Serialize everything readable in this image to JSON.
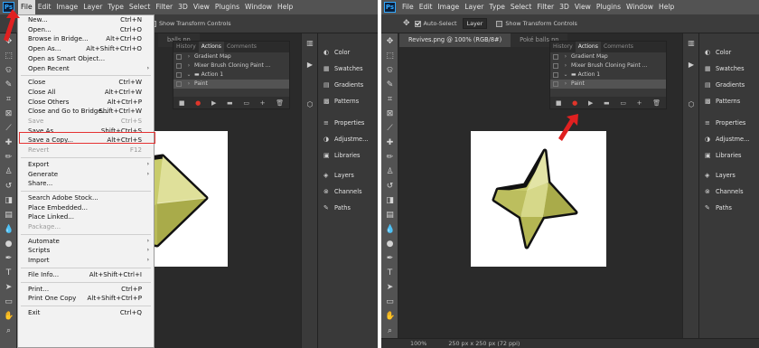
{
  "menubar_items": [
    "File",
    "Edit",
    "Image",
    "Layer",
    "Type",
    "Select",
    "Filter",
    "3D",
    "View",
    "Plugins",
    "Window",
    "Help"
  ],
  "ps_logo": "Ps",
  "options": {
    "auto_select": "Auto-Select",
    "layer_dropdown": "Layer",
    "show_transform": "Show Transform Controls"
  },
  "doc_tabs": {
    "active": "Revives.png @ 100% (RGB/8#)",
    "other": "Poké balls.pn"
  },
  "left_tab_partial": "balls.pn",
  "panel_tabs": [
    "History",
    "Actions",
    "Comments"
  ],
  "actions_rows_left": [
    "Gradient Map",
    "Mixer Brush Cloning Paint ...",
    "Action 1",
    "Paint"
  ],
  "actions_rows_right": [
    "Gradient Map",
    "Mixer Brush Cloning Paint ...",
    "Action 1",
    "Paint"
  ],
  "action_buttons": [
    "■",
    "●",
    "▶",
    "▬",
    "▭",
    "+",
    "🗑"
  ],
  "right_panels": [
    "Color",
    "Swatches",
    "Gradients",
    "Patterns",
    "Properties",
    "Adjustme...",
    "Libraries",
    "Layers",
    "Channels",
    "Paths"
  ],
  "right_icons": [
    "gradient-icon",
    "play-icon",
    "cube-icon"
  ],
  "status": {
    "zoom": "100%",
    "size": "250 px x 250 px (72 ppi)"
  },
  "file_menu": [
    {
      "label": "New...",
      "key": "Ctrl+N"
    },
    {
      "label": "Open...",
      "key": "Ctrl+O"
    },
    {
      "label": "Browse in Bridge...",
      "key": "Alt+Ctrl+O"
    },
    {
      "label": "Open As...",
      "key": "Alt+Shift+Ctrl+O"
    },
    {
      "label": "Open as Smart Object...",
      "key": ""
    },
    {
      "label": "Open Recent",
      "key": "",
      "sub": true
    },
    {
      "sep": true
    },
    {
      "label": "Close",
      "key": "Ctrl+W"
    },
    {
      "label": "Close All",
      "key": "Alt+Ctrl+W"
    },
    {
      "label": "Close Others",
      "key": "Alt+Ctrl+P"
    },
    {
      "label": "Close and Go to Bridge...",
      "key": "Shift+Ctrl+W"
    },
    {
      "label": "Save",
      "key": "Ctrl+S",
      "disabled": true
    },
    {
      "label": "Save As...",
      "key": "Shift+Ctrl+S"
    },
    {
      "label": "Save a Copy...",
      "key": "Alt+Ctrl+S"
    },
    {
      "label": "Revert",
      "key": "F12",
      "disabled": true
    },
    {
      "sep": true
    },
    {
      "label": "Export",
      "key": "",
      "sub": true
    },
    {
      "label": "Generate",
      "key": "",
      "sub": true
    },
    {
      "label": "Share...",
      "key": ""
    },
    {
      "sep": true
    },
    {
      "label": "Search Adobe Stock...",
      "key": ""
    },
    {
      "label": "Place Embedded...",
      "key": ""
    },
    {
      "label": "Place Linked...",
      "key": ""
    },
    {
      "label": "Package...",
      "key": "",
      "disabled": true
    },
    {
      "sep": true
    },
    {
      "label": "Automate",
      "key": "",
      "sub": true
    },
    {
      "label": "Scripts",
      "key": "",
      "sub": true
    },
    {
      "label": "Import",
      "key": "",
      "sub": true
    },
    {
      "sep": true
    },
    {
      "label": "File Info...",
      "key": "Alt+Shift+Ctrl+I"
    },
    {
      "sep": true
    },
    {
      "label": "Print...",
      "key": "Ctrl+P"
    },
    {
      "label": "Print One Copy",
      "key": "Alt+Shift+Ctrl+P"
    },
    {
      "sep": true
    },
    {
      "label": "Exit",
      "key": "Ctrl+Q"
    }
  ],
  "colors": {
    "highlight_box": "#e53232",
    "arrow": "#e02020",
    "star_fill": "#c9cc6c",
    "ps_blue": "#31a8ff"
  }
}
